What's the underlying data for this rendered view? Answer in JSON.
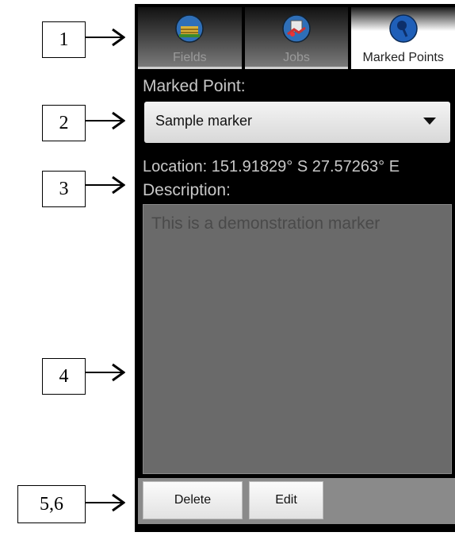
{
  "callouts": [
    "1",
    "2",
    "3",
    "4",
    "5,6"
  ],
  "tabs": [
    {
      "label": "Fields",
      "icon": "fields-icon"
    },
    {
      "label": "Jobs",
      "icon": "jobs-icon"
    },
    {
      "label": "Marked Points",
      "icon": "pin-icon"
    }
  ],
  "marked_point": {
    "label": "Marked Point:",
    "selected": "Sample marker"
  },
  "location": {
    "text": "Location: 151.91829° S 27.57263° E"
  },
  "description": {
    "label": "Description:",
    "value": "This is a demonstration marker"
  },
  "actions": {
    "delete_label": "Delete",
    "edit_label": "Edit"
  },
  "colors": {
    "background": "#000000",
    "panel": "#6a6a6a",
    "bar": "#8a8a8a",
    "icon_blue": "#1f5fb8"
  }
}
